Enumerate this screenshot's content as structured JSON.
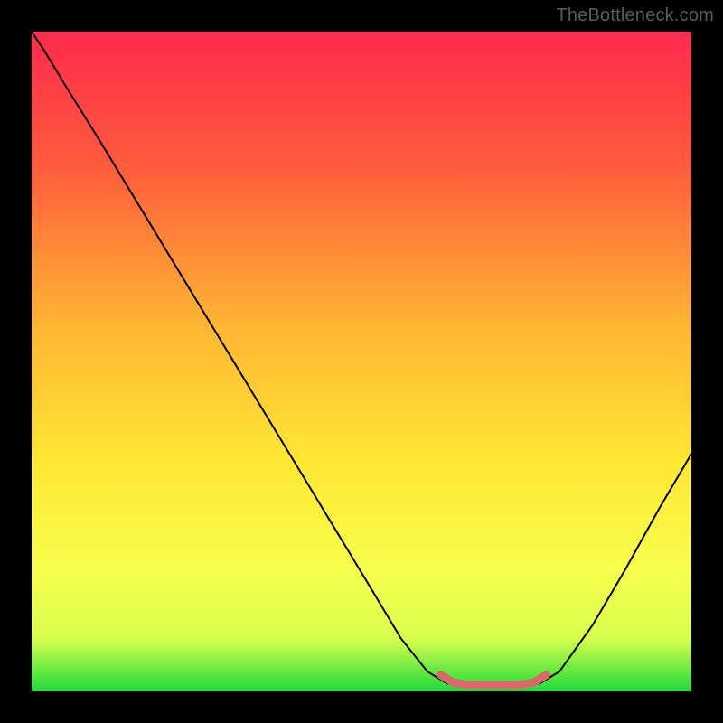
{
  "watermark": "TheBottleneck.com",
  "chart_data": {
    "type": "line",
    "title": "",
    "xlabel": "",
    "ylabel": "",
    "xlim": [
      0,
      100
    ],
    "ylim": [
      0,
      100
    ],
    "gradient_colors": [
      {
        "pos": 0.0,
        "color": "#ff2a4d"
      },
      {
        "pos": 0.2,
        "color": "#ff5a3c"
      },
      {
        "pos": 0.45,
        "color": "#ffb733"
      },
      {
        "pos": 0.65,
        "color": "#ffe733"
      },
      {
        "pos": 0.82,
        "color": "#f7ff4d"
      },
      {
        "pos": 0.92,
        "color": "#d8ff4d"
      },
      {
        "pos": 1.0,
        "color": "#1fdb3a"
      }
    ],
    "series": [
      {
        "name": "black-curve",
        "stroke": "#000000",
        "stroke_width": 2,
        "points_xy": [
          [
            0.0,
            100.0
          ],
          [
            2.0,
            97.0
          ],
          [
            5.0,
            92.0
          ],
          [
            10.0,
            84.0
          ],
          [
            20.0,
            67.5
          ],
          [
            30.0,
            51.0
          ],
          [
            40.0,
            34.5
          ],
          [
            50.0,
            18.0
          ],
          [
            56.0,
            8.0
          ],
          [
            60.0,
            3.0
          ],
          [
            63.0,
            1.2
          ],
          [
            65.0,
            1.0
          ],
          [
            70.0,
            1.0
          ],
          [
            75.0,
            1.0
          ],
          [
            77.0,
            1.2
          ],
          [
            80.0,
            3.0
          ],
          [
            85.0,
            10.0
          ],
          [
            90.0,
            18.5
          ],
          [
            95.0,
            27.5
          ],
          [
            100.0,
            36.0
          ]
        ]
      },
      {
        "name": "red-flat-region",
        "stroke": "#d96a6a",
        "stroke_width": 9,
        "points_xy": [
          [
            62.0,
            2.5
          ],
          [
            64.0,
            1.3
          ],
          [
            66.0,
            1.0
          ],
          [
            70.0,
            1.0
          ],
          [
            74.0,
            1.0
          ],
          [
            76.0,
            1.3
          ],
          [
            78.0,
            2.5
          ]
        ]
      }
    ]
  }
}
